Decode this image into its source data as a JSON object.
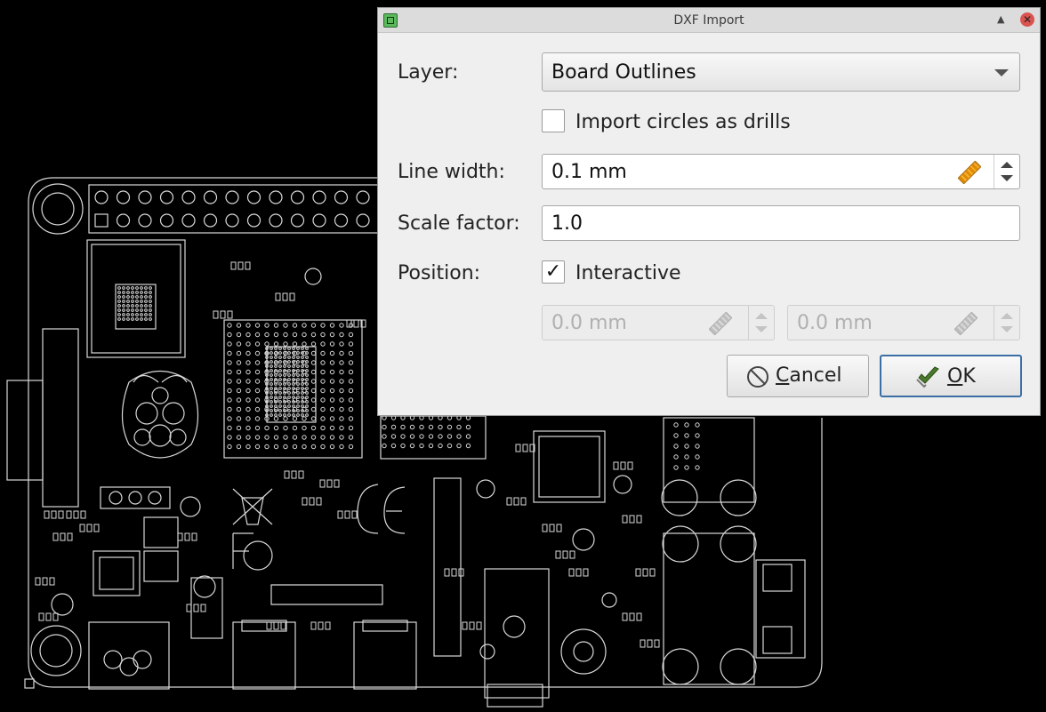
{
  "window": {
    "title": "DXF Import"
  },
  "form": {
    "layer_label": "Layer:",
    "layer_value": "Board Outlines",
    "circles_label": "Import circles as drills",
    "circles_checked": false,
    "line_width_label": "Line width:",
    "line_width_value": "0.1 mm",
    "scale_label": "Scale factor:",
    "scale_value": "1.0",
    "position_label": "Position:",
    "interactive_label": "Interactive",
    "interactive_checked": true,
    "interactive_mark": "✓",
    "pos_x_value": "0.0 mm",
    "pos_y_value": "0.0 mm"
  },
  "buttons": {
    "cancel_prefix": "",
    "cancel_mnemonic": "C",
    "cancel_rest": "ancel",
    "ok_mnemonic": "O",
    "ok_rest": "K"
  },
  "icons": {
    "app": "kicad-pcbnew-icon",
    "shade": "shade-icon",
    "close": "close-icon",
    "ruler": "ruler-icon",
    "cancel": "cancel-icon",
    "ok": "checkmark-icon"
  },
  "colors": {
    "canvas_bg": "#000000",
    "pcb_lines": "#d8d8d8",
    "dialog_bg": "#efefef",
    "accent": "#3a6ea5",
    "ruler_active": "#e08a00"
  }
}
